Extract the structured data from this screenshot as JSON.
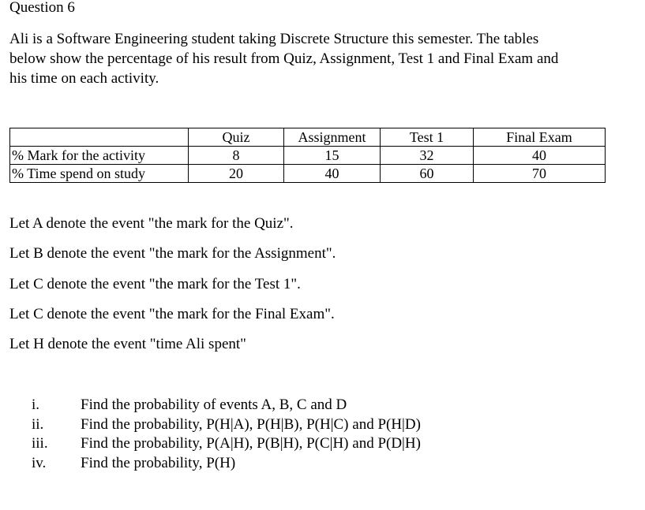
{
  "document": {
    "title": "Question 6",
    "intro_lines": [
      "Ali is a Software Engineering student taking Discrete Structure this semester. The tables",
      "below show the percentage of his result from Quiz, Assignment, Test 1 and Final Exam and",
      "his time on each activity."
    ],
    "table": {
      "headers": [
        "",
        "Quiz",
        "Assignment",
        "Test 1",
        "Final Exam"
      ],
      "rows": [
        {
          "label": "% Mark for the activity",
          "values": [
            "8",
            "15",
            "32",
            "40"
          ]
        },
        {
          "label": "% Time spend on study",
          "values": [
            "20",
            "40",
            "60",
            "70"
          ]
        }
      ]
    },
    "definitions": [
      "Let A denote the event \"the mark for the Quiz\".",
      "Let B denote the event \"the mark for the Assignment\".",
      "Let C denote the event \"the mark for the Test 1\".",
      "Let C denote the event \"the mark for the Final Exam\".",
      "Let H denote the event \"time Ali spent\""
    ],
    "questions": [
      {
        "num": "i.",
        "text": "Find the probability of events A, B, C and D"
      },
      {
        "num": "ii.",
        "text": "Find the probability, P(H|A), P(H|B), P(H|C) and P(H|D)"
      },
      {
        "num": "iii.",
        "text": "Find the probability, P(A|H), P(B|H), P(C|H) and P(D|H)"
      },
      {
        "num": "iv.",
        "text": "Find the probability, P(H)"
      }
    ]
  }
}
